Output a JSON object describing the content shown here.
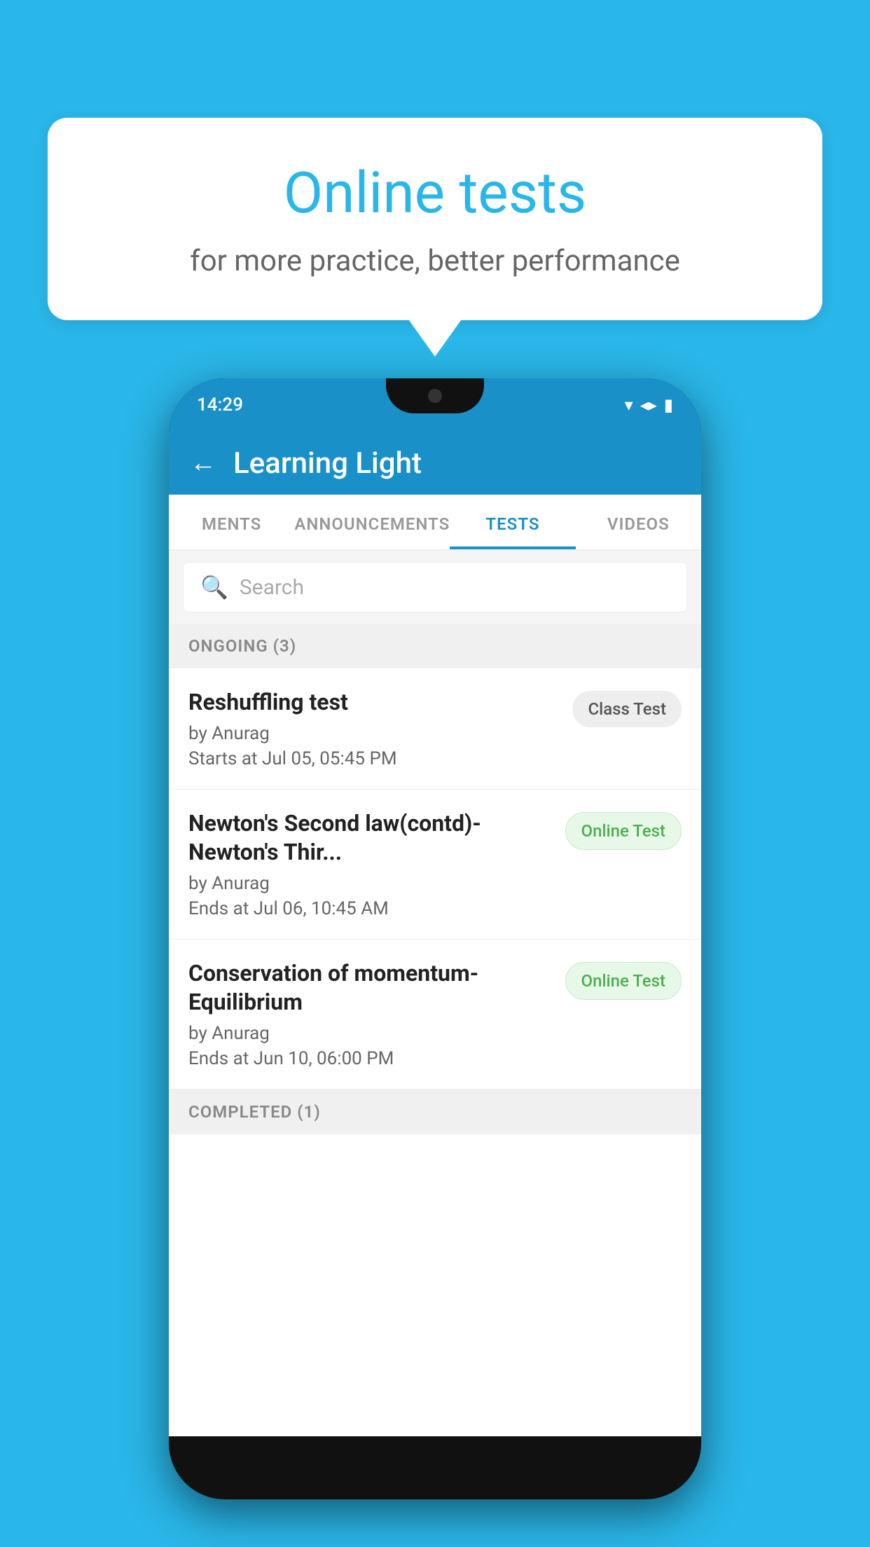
{
  "background": {
    "color": "#29b6e8"
  },
  "speech_bubble": {
    "title": "Online tests",
    "subtitle": "for more practice, better performance"
  },
  "phone": {
    "status_bar": {
      "time": "14:29",
      "icons": [
        "▾",
        "◂",
        "▮"
      ]
    },
    "header": {
      "back_label": "←",
      "title": "Learning Light"
    },
    "tabs": [
      {
        "label": "MENTS",
        "active": false
      },
      {
        "label": "ANNOUNCEMENTS",
        "active": false
      },
      {
        "label": "TESTS",
        "active": true
      },
      {
        "label": "VIDEOS",
        "active": false
      }
    ],
    "search": {
      "placeholder": "Search"
    },
    "sections": [
      {
        "label": "ONGOING (3)",
        "tests": [
          {
            "name": "Reshuffling test",
            "by": "by Anurag",
            "time": "Starts at  Jul 05, 05:45 PM",
            "badge": "Class Test",
            "badge_type": "class"
          },
          {
            "name": "Newton's Second law(contd)-Newton's Thir...",
            "by": "by Anurag",
            "time": "Ends at  Jul 06, 10:45 AM",
            "badge": "Online Test",
            "badge_type": "online"
          },
          {
            "name": "Conservation of momentum-Equilibrium",
            "by": "by Anurag",
            "time": "Ends at  Jun 10, 06:00 PM",
            "badge": "Online Test",
            "badge_type": "online"
          }
        ]
      }
    ],
    "completed_label": "COMPLETED (1)"
  }
}
